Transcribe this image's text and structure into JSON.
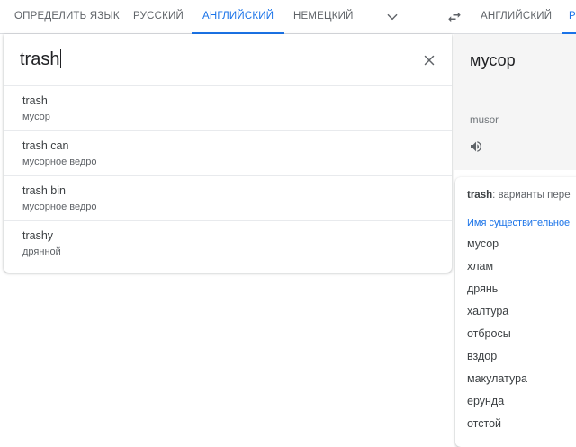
{
  "language_bar": {
    "source_tabs": [
      "ОПРЕДЕЛИТЬ ЯЗЫК",
      "РУССКИЙ",
      "АНГЛИЙСКИЙ",
      "НЕМЕЦКИЙ"
    ],
    "active_source_tab": "АНГЛИЙСКИЙ",
    "target_tabs": [
      "АНГЛИЙСКИЙ",
      "Р"
    ],
    "active_target_tab": "Р"
  },
  "source": {
    "text": "trash",
    "suggestions": [
      {
        "term": "trash",
        "translation": "мусор"
      },
      {
        "term": "trash can",
        "translation": "мусорное ведро"
      },
      {
        "term": "trash bin",
        "translation": "мусорное ведро"
      },
      {
        "term": "trashy",
        "translation": "дрянной"
      }
    ]
  },
  "target": {
    "text": "мусор",
    "transliteration": "musor"
  },
  "dictionary": {
    "term": "trash",
    "title_suffix": ": варианты пере",
    "part_of_speech": "Имя существительное",
    "entries": [
      "мусор",
      "хлам",
      "дрянь",
      "халтура",
      "отбросы",
      "вздор",
      "макулатура",
      "ерунда",
      "отстой"
    ]
  },
  "colors": {
    "accent": "#1a73e8",
    "target_bg": "#f5f5f5"
  },
  "icons": {
    "more_languages": "chevron-down-icon",
    "swap": "swap-arrows-icon",
    "clear": "close-icon",
    "listen": "speaker-icon"
  }
}
